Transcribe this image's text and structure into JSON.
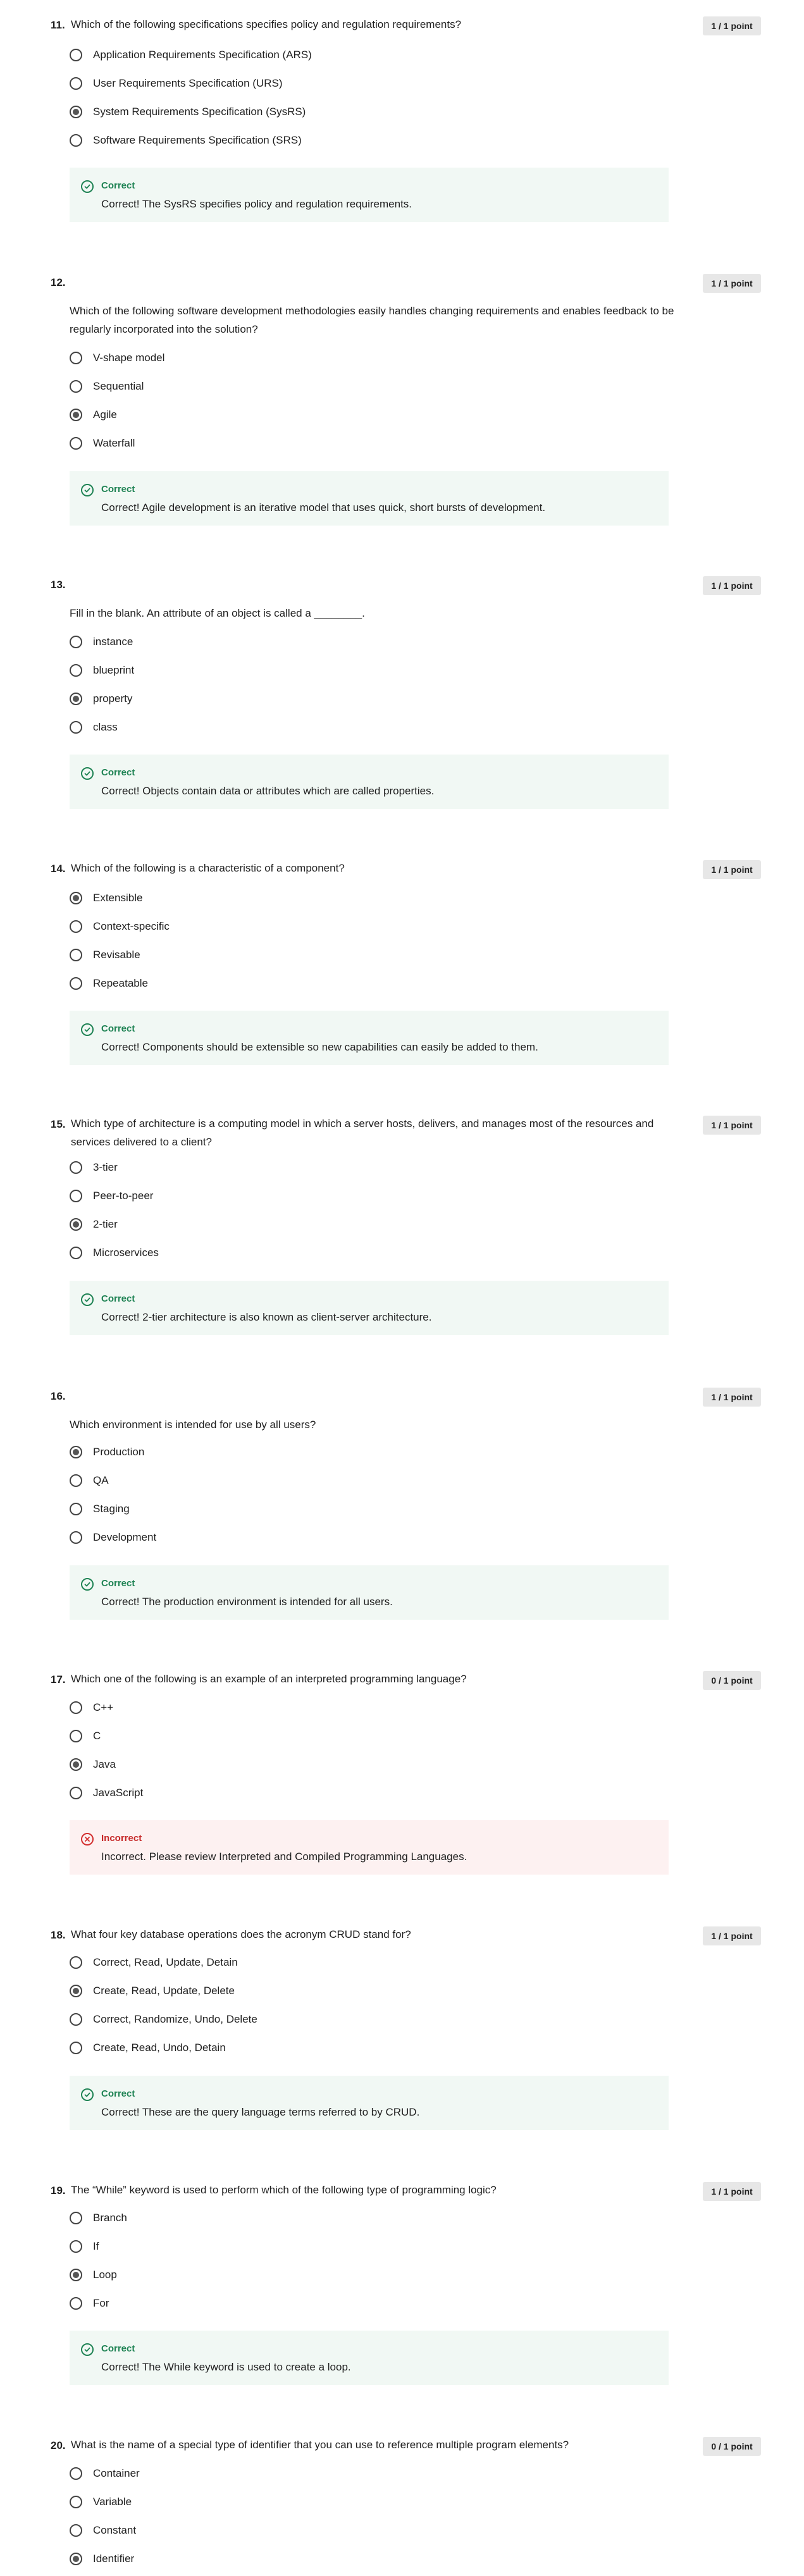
{
  "colors": {
    "correct_accent": "#1f8354",
    "incorrect_accent": "#c62828",
    "correct_bg": "#f1f8f4",
    "incorrect_bg": "#fdf1f1",
    "badge_bg": "#e7e7e7"
  },
  "questions": [
    {
      "number": "11.",
      "question": "Which of the following specifications specifies policy and regulation requirements?",
      "score": "1 / 1 point",
      "options": [
        "Application Requirements Specification (ARS)",
        "User Requirements Specification (URS)",
        "System Requirements Specification (SysRS)",
        "Software Requirements Specification (SRS)"
      ],
      "selected_index": 2,
      "feedback": {
        "status": "Correct",
        "icon": "check-circle-icon",
        "text": "Correct! The SysRS specifies policy and regulation requirements."
      }
    },
    {
      "number": "12.",
      "question": "Which of the following software development methodologies easily handles changing requirements and enables feedback to be regularly incorporated into the solution?",
      "score": "1 / 1 point",
      "options": [
        "V-shape model",
        "Sequential",
        "Agile",
        "Waterfall"
      ],
      "selected_index": 2,
      "feedback": {
        "status": "Correct",
        "icon": "check-circle-icon",
        "text": "Correct! Agile development is an iterative model that uses quick, short bursts of development."
      }
    },
    {
      "number": "13.",
      "question": "Fill in the blank. An attribute of an object is called a ________.",
      "score": "1 / 1 point",
      "options": [
        "instance",
        "blueprint",
        "property",
        "class"
      ],
      "selected_index": 2,
      "feedback": {
        "status": "Correct",
        "icon": "check-circle-icon",
        "text": "Correct! Objects contain data or attributes which are called properties."
      }
    },
    {
      "number": "14.",
      "question": "Which of the following is a characteristic of a component?",
      "score": "1 / 1 point",
      "options": [
        "Extensible",
        "Context-specific",
        "Revisable",
        "Repeatable"
      ],
      "selected_index": 0,
      "feedback": {
        "status": "Correct",
        "icon": "check-circle-icon",
        "text": "Correct! Components should be extensible so new capabilities can easily be added to them."
      }
    },
    {
      "number": "15.",
      "question": "Which type of architecture is a computing model in which a server hosts, delivers, and manages most of the resources and services delivered to a client?",
      "score": "1 / 1 point",
      "options": [
        "3-tier",
        "Peer-to-peer",
        "2-tier",
        "Microservices"
      ],
      "selected_index": 2,
      "feedback": {
        "status": "Correct",
        "icon": "check-circle-icon",
        "text": "Correct! 2-tier architecture is also known as client-server architecture."
      }
    },
    {
      "number": "16.",
      "question": "Which environment is intended for use by all users?",
      "score": "1 / 1 point",
      "options": [
        "Production",
        "QA",
        "Staging",
        "Development"
      ],
      "selected_index": 0,
      "feedback": {
        "status": "Correct",
        "icon": "check-circle-icon",
        "text": "Correct! The production environment is intended for all users."
      }
    },
    {
      "number": "17.",
      "question": "Which one of the following is an example of an interpreted programming language?",
      "score": "0 / 1 point",
      "options": [
        "C++",
        "C",
        "Java",
        "JavaScript"
      ],
      "selected_index": 2,
      "feedback": {
        "status": "Incorrect",
        "icon": "x-circle-icon",
        "text": "Incorrect. Please review Interpreted and Compiled Programming Languages."
      }
    },
    {
      "number": "18.",
      "question": "What four key database operations does the acronym CRUD stand for?",
      "score": "1 / 1 point",
      "options": [
        "Correct, Read, Update, Detain",
        "Create, Read, Update, Delete",
        "Correct, Randomize, Undo, Delete",
        "Create, Read, Undo, Detain"
      ],
      "selected_index": 1,
      "feedback": {
        "status": "Correct",
        "icon": "check-circle-icon",
        "text": "Correct! These are the query language terms referred to by CRUD."
      }
    },
    {
      "number": "19.",
      "question": "The “While” keyword is used to perform which of the following type of programming logic?",
      "score": "1 / 1 point",
      "options": [
        "Branch",
        "If",
        "Loop",
        "For"
      ],
      "selected_index": 2,
      "feedback": {
        "status": "Correct",
        "icon": "check-circle-icon",
        "text": "Correct! The While keyword is used to create a loop."
      }
    },
    {
      "number": "20.",
      "question": "What is the name of a special type of identifier that you can use to reference multiple program elements?",
      "score": "0 / 1 point",
      "options": [
        "Container",
        "Variable",
        "Constant",
        "Identifier"
      ],
      "selected_index": 3
    }
  ]
}
